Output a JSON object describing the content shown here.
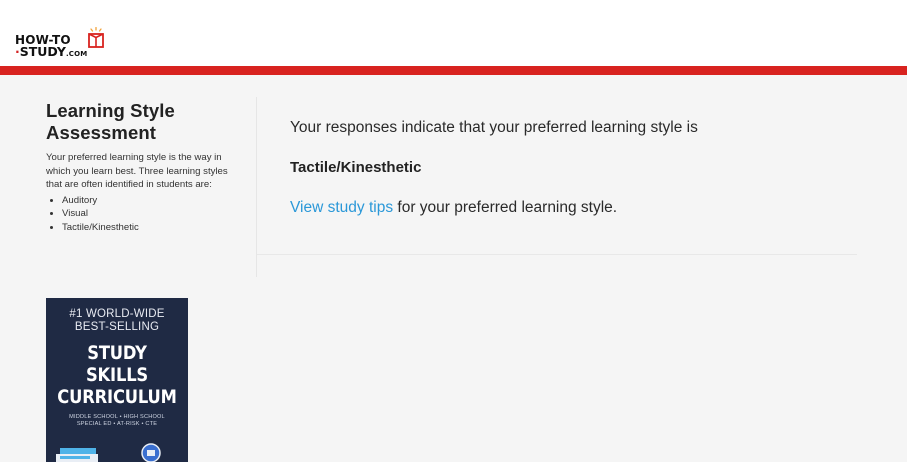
{
  "header": {
    "logo_line1": "HOW-TO",
    "logo_dot": "·",
    "logo_line2": "STUDY",
    "logo_com": ".COM"
  },
  "sidebar": {
    "title": "Learning Style Assessment",
    "description": "Your preferred learning style is the way in which you learn best. Three learning styles that are often identified in students are:",
    "styles": [
      "Auditory",
      "Visual",
      "Tactile/Kinesthetic"
    ]
  },
  "main": {
    "result_text": "Your responses indicate that your preferred learning style is",
    "style_name": "Tactile/Kinesthetic",
    "tips_link": "View study tips",
    "tips_suffix": " for your preferred learning style."
  },
  "promo": {
    "top_line1": "#1 WORLD-WIDE",
    "top_line2": "BEST-SELLING",
    "title_line1": "STUDY SKILLS",
    "title_line2": "CURRICULUM",
    "sub_line1": "MIDDLE SCHOOL • HIGH SCHOOL",
    "sub_line2": "SPECIAL ED • AT-RISK • CTE"
  },
  "colors": {
    "accent_red": "#d8231f",
    "link_blue": "#2b98d8",
    "promo_navy": "#1f2a44"
  },
  "icons": {
    "logo": "gift-box-icon"
  }
}
